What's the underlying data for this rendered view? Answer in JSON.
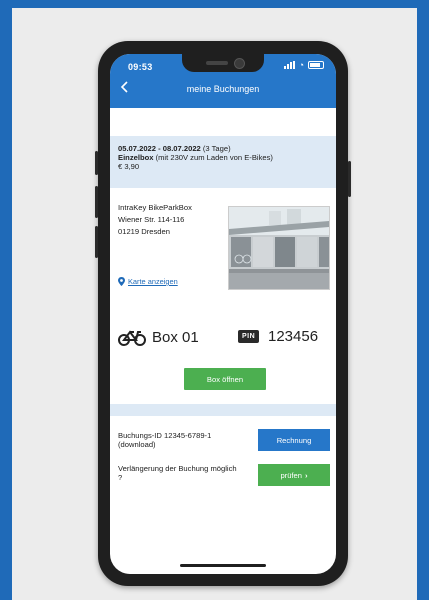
{
  "status_bar": {
    "time": "09:53"
  },
  "header": {
    "title": "meine Buchungen"
  },
  "booking": {
    "dates": "05.07.2022 - 08.07.2022",
    "duration": "(3 Tage)",
    "type": "Einzelbox",
    "type_note": "(mit 230V zum Laden von E-Bikes)",
    "price": "€ 3,90"
  },
  "location": {
    "name": "IntraKey BikeParkBox",
    "street": "Wiener Str. 114-116",
    "city": "01219 Dresden",
    "map_link": "Karte anzeigen"
  },
  "box": {
    "label": "Box 01",
    "pin_badge": "PIN",
    "pin_code": "123456",
    "open_button": "Box öffnen"
  },
  "actions": {
    "booking_id_text": "Buchungs-ID 12345-6789-1 (download)",
    "invoice_button": "Rechnung",
    "extension_text": "Verlängerung der Buchung möglich ?",
    "check_button": "prüfen",
    "check_chevron": "›"
  },
  "colors": {
    "brand_blue": "#2677c9",
    "accent_green": "#4caf50",
    "header_bg": "#dde9f5"
  },
  "icons": [
    "chevron-left-icon",
    "signal-icon",
    "wifi-icon",
    "battery-icon",
    "map-pin-icon",
    "bike-icon"
  ]
}
